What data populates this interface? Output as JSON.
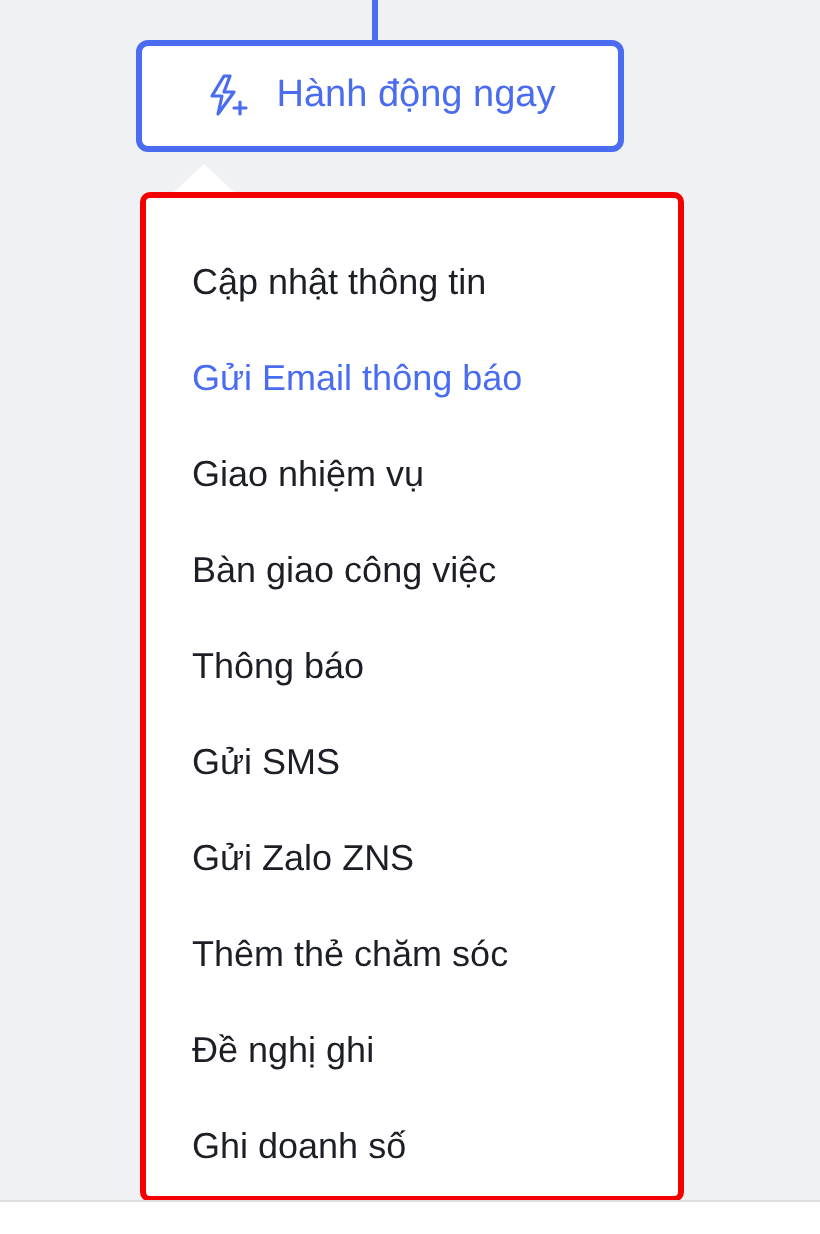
{
  "action_button": {
    "label": "Hành động ngay"
  },
  "menu": {
    "items": [
      {
        "label": "Cập nhật thông tin",
        "selected": false
      },
      {
        "label": "Gửi Email thông báo",
        "selected": true
      },
      {
        "label": "Giao nhiệm vụ",
        "selected": false
      },
      {
        "label": "Bàn giao công việc",
        "selected": false
      },
      {
        "label": "Thông báo",
        "selected": false
      },
      {
        "label": "Gửi SMS",
        "selected": false
      },
      {
        "label": "Gửi Zalo ZNS",
        "selected": false
      },
      {
        "label": "Thêm thẻ chăm sóc",
        "selected": false
      },
      {
        "label": "Đề nghị ghi",
        "selected": false
      },
      {
        "label": "Ghi doanh số",
        "selected": false
      }
    ]
  }
}
